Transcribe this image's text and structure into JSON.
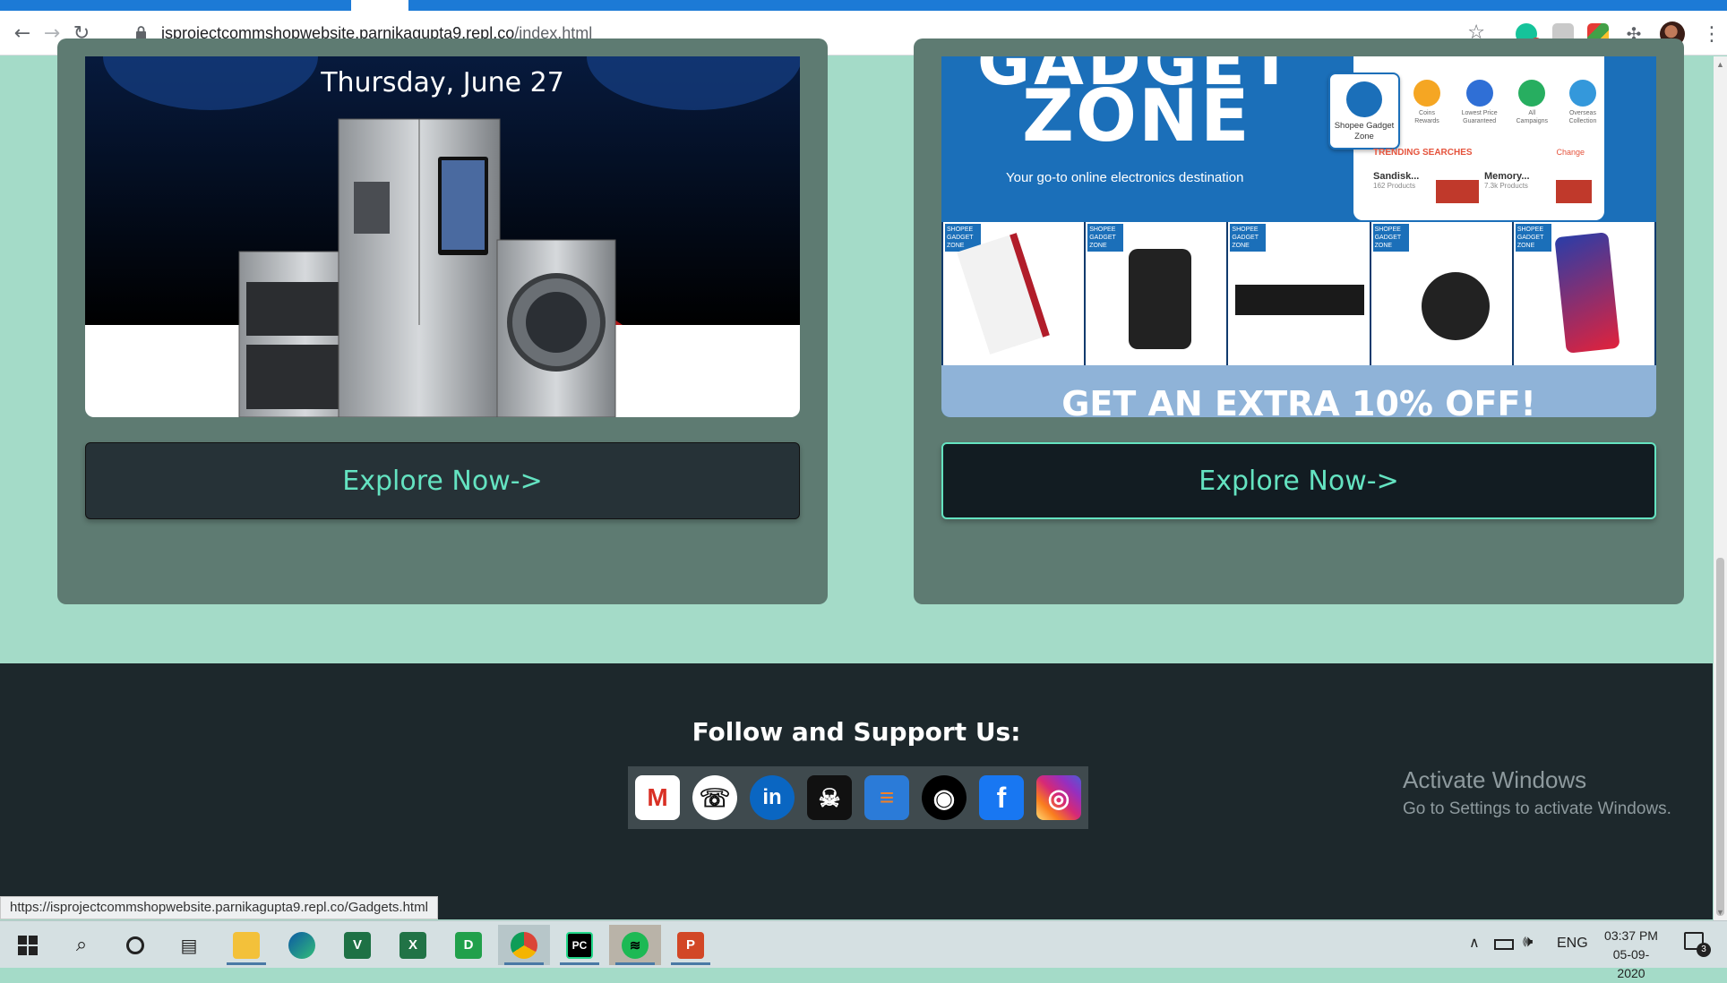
{
  "browser": {
    "url_host": "isprojectcommshopwebsite.parnikagupta9.repl.co",
    "url_path": "/index.html",
    "extension_badge": "6"
  },
  "cards": [
    {
      "banner_caption": "Thursday, June 27",
      "button_label": "Explore Now->"
    },
    {
      "banner_title": "ZONE",
      "banner_partial_title": "GADGET",
      "banner_subtitle": "Your go-to online electronics destination",
      "banner_promo": "GET AN EXTRA 10% OFF!",
      "panel_items": [
        "Shopee Gadget Zone",
        "Coins Rewards",
        "Lowest Price Guaranteed",
        "All Campaigns",
        "Overseas Collection"
      ],
      "trending_label": "TRENDING SEARCHES",
      "change_label": "Change",
      "trending": [
        {
          "name": "Sandisk...",
          "count": "162 Products"
        },
        {
          "name": "Memory...",
          "count": "7.3k Products"
        }
      ],
      "tile_badge": "SHOPEE GADGET ZONE",
      "button_label": "Explore Now->"
    }
  ],
  "footer": {
    "heading": "Follow and Support Us:",
    "social": [
      {
        "name": "gmail",
        "glyph": "M"
      },
      {
        "name": "phone",
        "glyph": "☏"
      },
      {
        "name": "linkedin",
        "glyph": "in"
      },
      {
        "name": "hackerrank",
        "glyph": "☠"
      },
      {
        "name": "stackoverflow",
        "glyph": "≡"
      },
      {
        "name": "github",
        "glyph": "◉"
      },
      {
        "name": "facebook",
        "glyph": "f"
      },
      {
        "name": "instagram",
        "glyph": "◎"
      }
    ]
  },
  "watermark": {
    "title": "Activate Windows",
    "subtitle": "Go to Settings to activate Windows."
  },
  "status_url": "https://isprojectcommshopwebsite.parnikagupta9.repl.co/Gadgets.html",
  "taskbar": {
    "language": "ENG",
    "time": "03:37 PM",
    "date": "05-09-2020",
    "notification_count": "3"
  },
  "colors": {
    "page_bg": "#a4dbc8",
    "card_bg": "#5e7b72",
    "accent": "#64e3c1",
    "footer_bg": "#1d282c",
    "shopee_blue": "#1b6fb9"
  }
}
